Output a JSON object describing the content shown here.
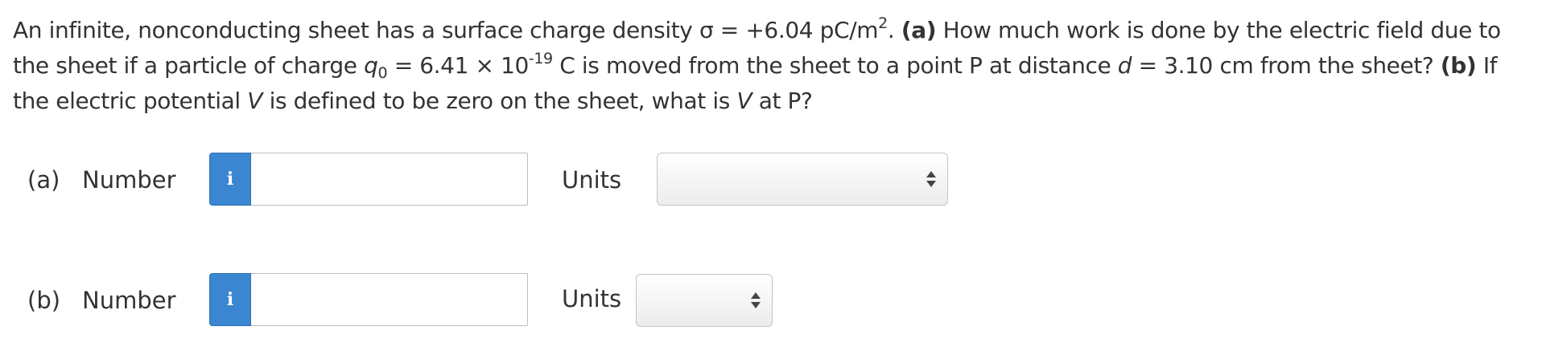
{
  "problem": {
    "t1": "An infinite, nonconducting sheet has a surface charge density σ = +6.04 pC/m",
    "sup1": "2",
    "t2": ". ",
    "part_a": "(a)",
    "t3": " How much work is done by the electric field due to the sheet if a particle of charge ",
    "q_var": "q",
    "q_sub": "0",
    "t4": " = 6.41 × 10",
    "exp": "-19",
    "t5": " C is moved from the sheet to a point P at distance ",
    "d_var": "d",
    "t6": " = 3.10 cm from the sheet? ",
    "part_b": "(b)",
    "t7": " If the electric potential ",
    "v_var1": "V",
    "t8": " is defined to be zero on the sheet, what is ",
    "v_var2": "V",
    "t9": " at P?"
  },
  "answers": [
    {
      "part_label": "(a)",
      "number_label": "Number",
      "info_symbol": "i",
      "number_value": "",
      "units_label": "Units",
      "units_selected": ""
    },
    {
      "part_label": "(b)",
      "number_label": "Number",
      "info_symbol": "i",
      "number_value": "",
      "units_label": "Units",
      "units_selected": ""
    }
  ],
  "colors": {
    "info_button": "#3a86d0",
    "text": "#333333"
  },
  "icons": {
    "info": "info-icon",
    "select_arrows": "up-down-arrows-icon"
  }
}
